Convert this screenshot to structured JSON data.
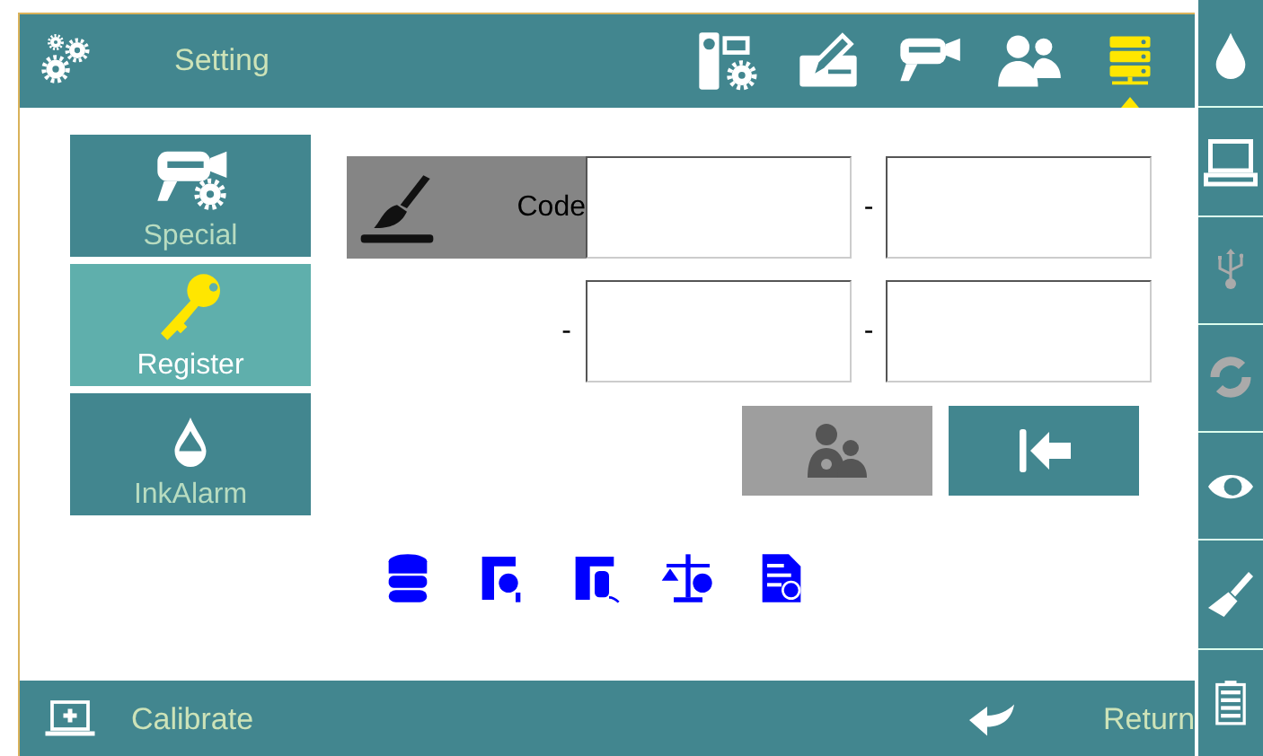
{
  "header": {
    "title": "Setting",
    "tools": [
      {
        "kind": "camera-gear",
        "selected": false
      },
      {
        "kind": "pencil",
        "selected": false
      },
      {
        "kind": "printhead",
        "selected": false
      },
      {
        "kind": "users",
        "selected": false
      },
      {
        "kind": "server",
        "selected": true
      }
    ]
  },
  "side_menu": [
    {
      "kind": "printhead-gear",
      "label": "Special",
      "selected": false
    },
    {
      "kind": "keys",
      "label": "Register",
      "selected": true
    },
    {
      "kind": "drop",
      "label": "InkAlarm",
      "selected": false
    }
  ],
  "code_rows": [
    {
      "kind": "brush",
      "lead": "Code",
      "separator": "-"
    },
    {
      "kind": "plain",
      "lead": "-",
      "separator": "-"
    }
  ],
  "actions": [
    {
      "kind": "key-users",
      "disabled": true
    },
    {
      "kind": "back",
      "disabled": false
    }
  ],
  "footer": {
    "left": "Calibrate",
    "right": "Return"
  }
}
